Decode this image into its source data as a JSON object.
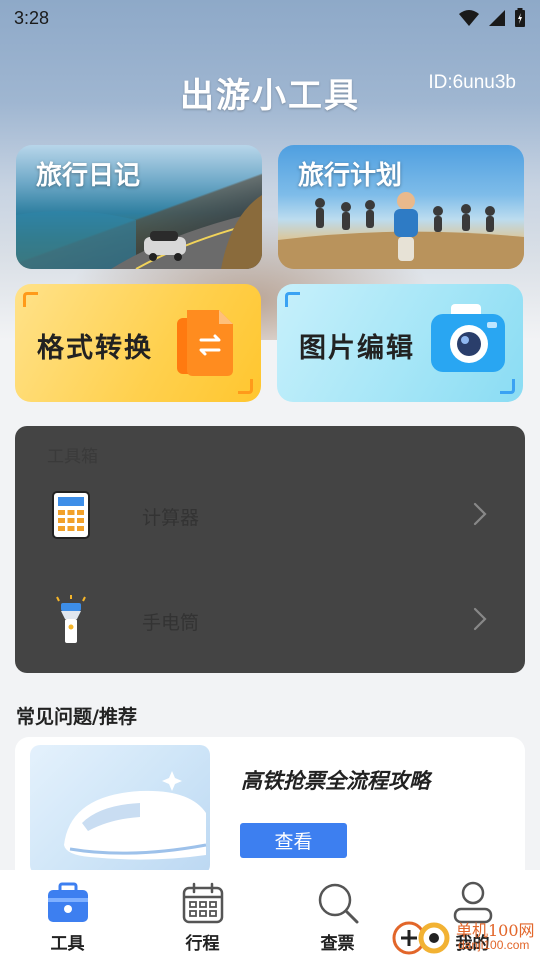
{
  "status": {
    "time": "3:28"
  },
  "header": {
    "title": "出游小工具",
    "user_id": "ID:6unu3b"
  },
  "photo_cards": [
    {
      "label": "旅行日记"
    },
    {
      "label": "旅行计划"
    }
  ],
  "feature_cards": [
    {
      "label": "格式转换"
    },
    {
      "label": "图片编辑"
    }
  ],
  "toolbox": {
    "title": "工具箱",
    "items": [
      {
        "label": "计算器"
      },
      {
        "label": "手电筒"
      }
    ]
  },
  "recommend": {
    "section_title": "常见问题/推荐",
    "card_title": "高铁抢票全流程攻略",
    "button_label": "查看"
  },
  "nav": {
    "items": [
      {
        "label": "工具",
        "icon": "toolbox-icon",
        "active": true
      },
      {
        "label": "行程",
        "icon": "calendar-icon",
        "active": false
      },
      {
        "label": "查票",
        "icon": "search-icon",
        "active": false
      },
      {
        "label": "我的",
        "icon": "user-icon",
        "active": false
      }
    ]
  },
  "watermark": {
    "line1": "单机100网",
    "line2": "danji100.com"
  },
  "colors": {
    "accent": "#3d7ff0",
    "toolbox_bg": "#444444",
    "format_card": "#ffd04d",
    "edit_card": "#a6e6f7"
  }
}
